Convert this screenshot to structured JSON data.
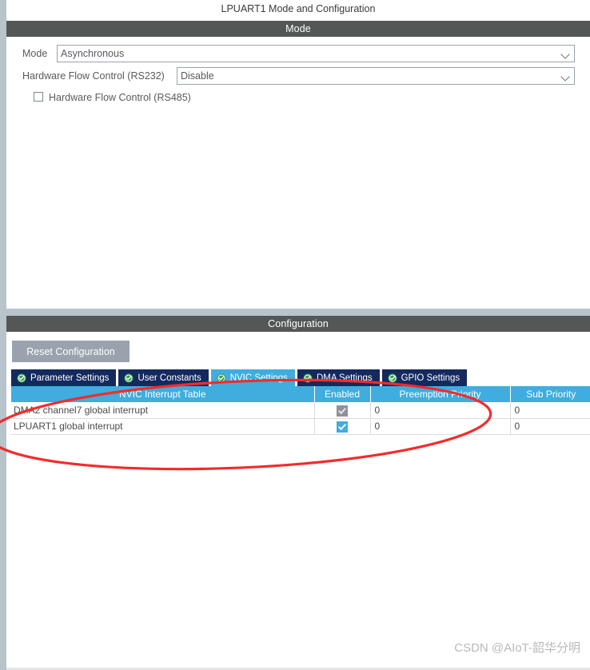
{
  "window": {
    "title": "LPUART1 Mode and Configuration"
  },
  "mode_section": {
    "band_title": "Mode",
    "fields": [
      {
        "label": "Mode",
        "value": "Asynchronous",
        "icon": "chevron-down-icon"
      },
      {
        "label": "Hardware Flow Control (RS232)",
        "value": "Disable",
        "icon": "chevron-down-icon"
      }
    ],
    "checkbox": {
      "label": "Hardware Flow Control (RS485)",
      "checked": false
    }
  },
  "config_section": {
    "band_title": "Configuration",
    "reset_button": "Reset Configuration",
    "tabs": [
      {
        "label": "Parameter Settings",
        "icon": "check-circle-icon",
        "active": false
      },
      {
        "label": "User Constants",
        "icon": "check-circle-icon",
        "active": false
      },
      {
        "label": "NVIC Settings",
        "icon": "check-circle-icon",
        "active": true
      },
      {
        "label": "DMA Settings",
        "icon": "check-circle-icon",
        "active": false
      },
      {
        "label": "GPIO Settings",
        "icon": "check-circle-icon",
        "active": false
      }
    ],
    "table": {
      "headers": [
        "NVIC Interrupt Table",
        "Enabled",
        "Preemption Priority",
        "Sub Priority"
      ],
      "rows": [
        {
          "name": "DMA2 channel7 global interrupt",
          "enabled": true,
          "enabled_state": "locked",
          "preemption_priority": "0",
          "sub_priority": "0"
        },
        {
          "name": "LPUART1 global interrupt",
          "enabled": true,
          "enabled_state": "active",
          "preemption_priority": "0",
          "sub_priority": "0"
        }
      ]
    }
  },
  "annotation": {
    "shape": "ellipse",
    "color": "#f42b2b"
  },
  "watermark": {
    "text": "CSDN @AIoT-韶华分明"
  },
  "colors": {
    "band": "#545756",
    "tab_inactive": "#142a5e",
    "tab_active": "#3fadde",
    "table_header": "#3fadde",
    "edge_strip": "#b7c4cc",
    "reset_button": "#9aa2ad",
    "annotation_red": "#f42b2b"
  }
}
